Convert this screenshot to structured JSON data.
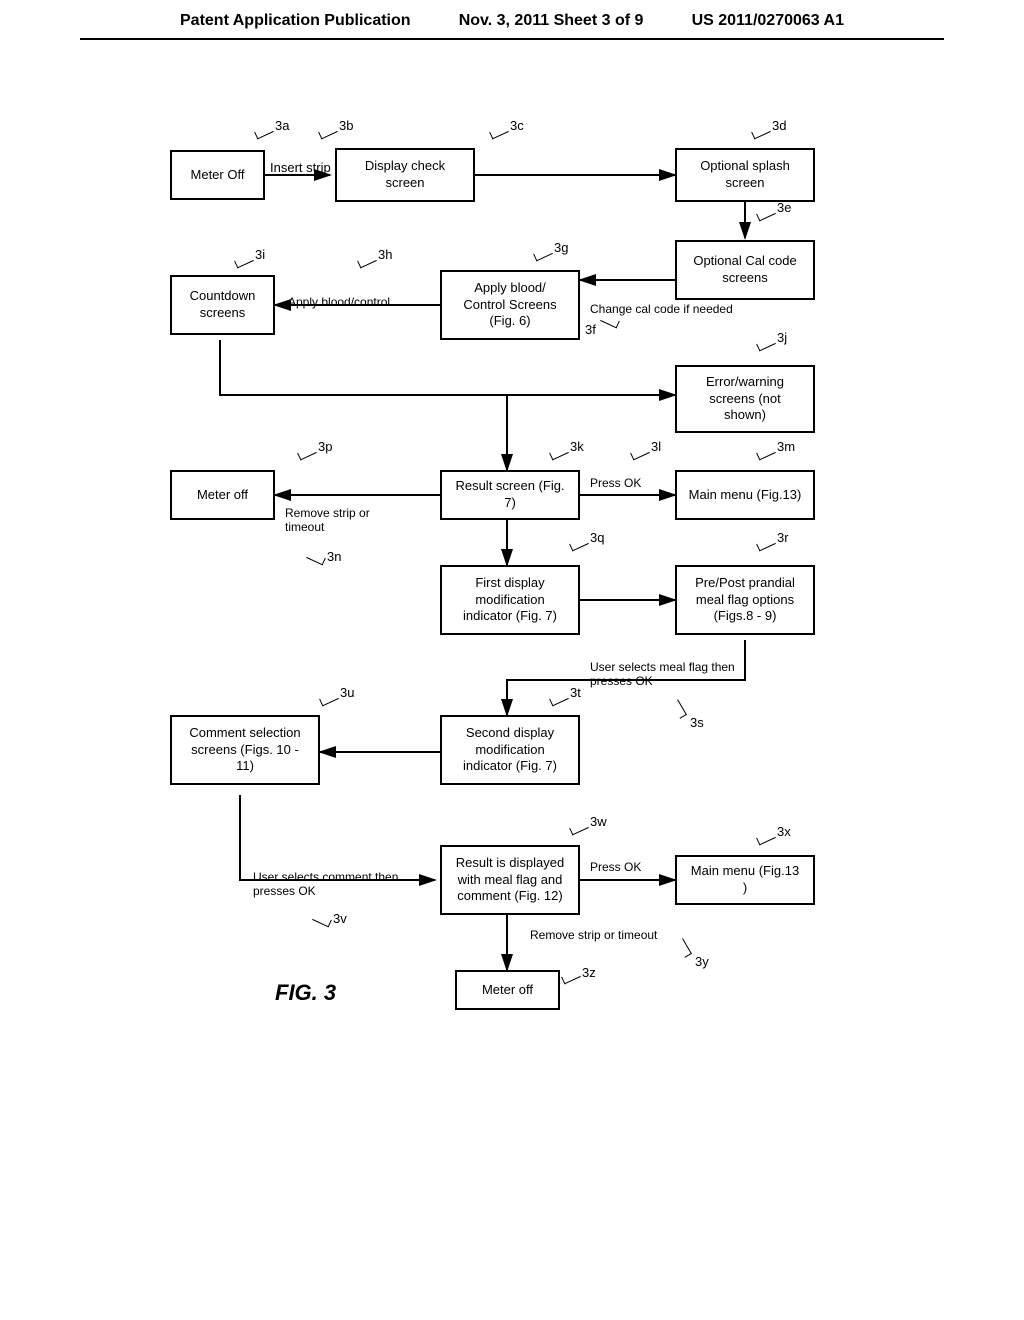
{
  "header": {
    "left": "Patent Application Publication",
    "center": "Nov. 3, 2011   Sheet 3 of 9",
    "right": "US 2011/0270063 A1"
  },
  "boxes": {
    "b3a": "Meter Off",
    "b3c": "Display check screen",
    "b3d": "Optional splash screen",
    "b3e": "Optional Cal code screens",
    "b3g": "Apply blood/ Control Screens (Fig. 6)",
    "b3i": "Countdown screens",
    "b3j": "Error/warning screens (not shown)",
    "b3k": "Result screen (Fig. 7)",
    "b3m": "Main menu (Fig.13)",
    "b3p": "Meter off",
    "b3q": "First display modification indicator (Fig. 7)",
    "b3r": "Pre/Post prandial meal flag options (Figs.8 - 9)",
    "b3t": "Second display modification indicator (Fig. 7)",
    "b3u": "Comment selection screens (Figs. 10 - 11)",
    "b3w": "Result is displayed with meal flag and comment (Fig. 12)",
    "b3x": "Main menu (Fig.13 )",
    "b3z": "Meter off"
  },
  "labels": {
    "l3a": "3a",
    "l3b": "3b",
    "l3c": "3c",
    "l3d": "3d",
    "l3e": "3e",
    "l3f": "3f",
    "l3g": "3g",
    "l3h": "3h",
    "l3i": "3i",
    "l3j": "3j",
    "l3k": "3k",
    "l3l": "3l",
    "l3m": "3m",
    "l3n": "3n",
    "l3p": "3p",
    "l3q": "3q",
    "l3r": "3r",
    "l3s": "3s",
    "l3t": "3t",
    "l3u": "3u",
    "l3v": "3v",
    "l3w": "3w",
    "l3x": "3x",
    "l3y": "3y",
    "l3z": "3z",
    "arrow_3b": "Insert strip",
    "arrow_3h": "Apply blood/control",
    "arrow_3f": "Change cal code if needed",
    "arrow_3l": "Press OK",
    "arrow_3n": "Remove strip or timeout",
    "arrow_3s": "User selects meal flag then presses  OK",
    "arrow_press_ok": "Press OK",
    "arrow_3v": "User selects comment then presses OK",
    "arrow_3y": "Remove strip or timeout"
  },
  "figure_caption": "FIG. 3"
}
